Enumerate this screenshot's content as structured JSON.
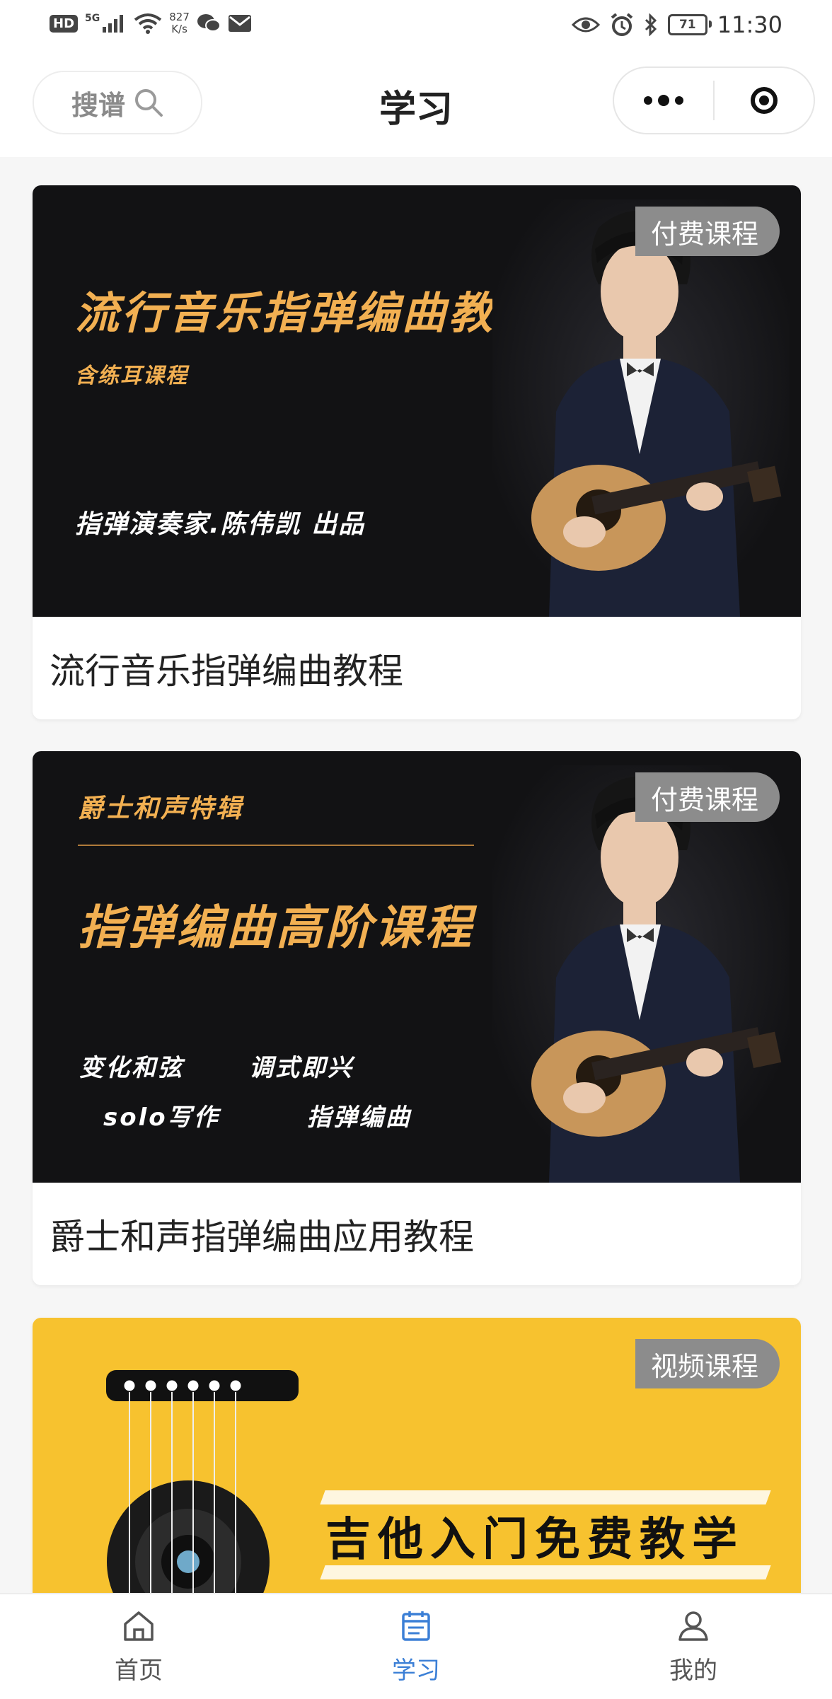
{
  "status_bar": {
    "hd": "HD",
    "network_gen": "5G",
    "speed_value": "827",
    "speed_unit": "K/s",
    "battery": "71",
    "time": "11:30"
  },
  "nav": {
    "search_label": "搜谱",
    "title": "学习"
  },
  "cards": [
    {
      "tag": "付费课程",
      "banner_title": "流行音乐指弹编曲教程",
      "banner_subtitle": "含练耳课程",
      "banner_credit": "指弹演奏家.陈伟凯  出品",
      "title": "流行音乐指弹编曲教程"
    },
    {
      "tag": "付费课程",
      "banner_kicker": "爵士和声特辑",
      "banner_title": "指弹编曲高阶课程",
      "banner_topics": [
        "变化和弦",
        "调式即兴",
        "solo写作",
        "指弹编曲"
      ],
      "title": "爵士和声指弹编曲应用教程"
    },
    {
      "tag": "视频课程",
      "banner_title": "吉他入门免费教学"
    }
  ],
  "tabbar": {
    "items": [
      {
        "label": "首页",
        "icon": "home-icon"
      },
      {
        "label": "学习",
        "icon": "calendar-icon",
        "active": true
      },
      {
        "label": "我的",
        "icon": "user-icon"
      }
    ]
  },
  "colors": {
    "accent": "#3b7fd6",
    "banner_gold": "#f2b052",
    "banner_yellow": "#f7c22f",
    "tag_gray": "#8c8c8c"
  }
}
